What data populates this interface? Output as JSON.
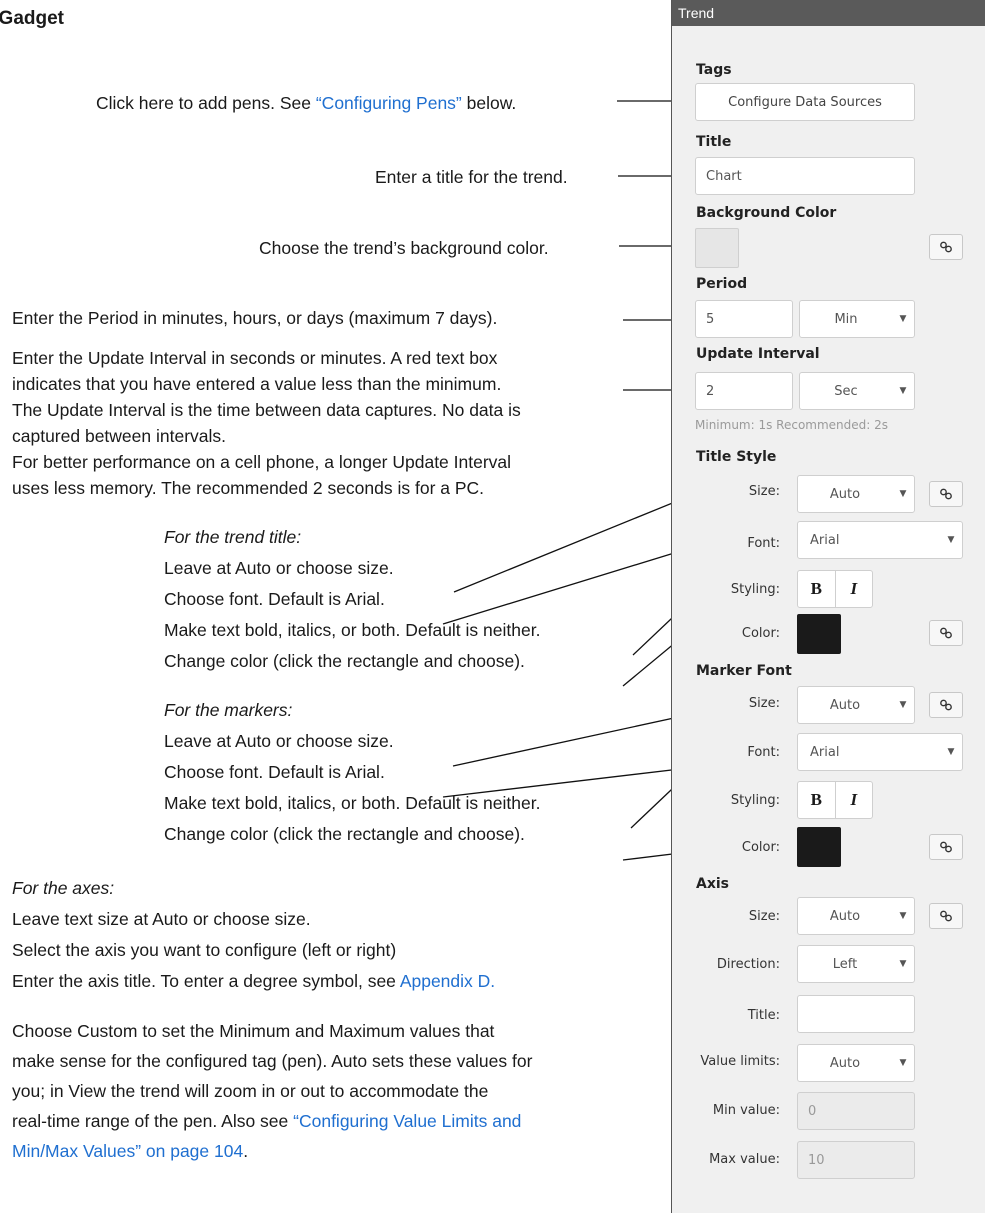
{
  "heading": "l Gadget",
  "panel": {
    "header": "Trend",
    "tags_label": "Tags",
    "configure_button": "Configure Data Sources",
    "title_label": "Title",
    "title_value": "Chart",
    "bg_color_label": "Background Color",
    "period_label": "Period",
    "period_value": "5",
    "period_unit": "Min",
    "update_label": "Update Interval",
    "update_value": "2",
    "update_unit": "Sec",
    "update_hint": "Minimum: 1s Recommended: 2s",
    "title_style_label": "Title Style",
    "marker_font_label": "Marker Font",
    "axis_label": "Axis",
    "size_label": "Size:",
    "font_label": "Font:",
    "styling_label": "Styling:",
    "color_label": "Color:",
    "size_value": "Auto",
    "font_value": "Arial",
    "bold": "B",
    "italic": "I",
    "direction_label": "Direction:",
    "direction_value": "Left",
    "axis_title_label": "Title:",
    "value_limits_label": "Value limits:",
    "value_limits_value": "Auto",
    "min_label": "Min value:",
    "min_value": "0",
    "max_label": "Max value:",
    "max_value": "10",
    "colors": {
      "header_bg": "#5a5a5a",
      "panel_bg": "#f0f0f0",
      "swatch_light": "#e6e6e6",
      "swatch_dark": "#1a1a1a"
    }
  },
  "annotations": {
    "tags_a": "Click here to add pens. See ",
    "tags_link": "“Configuring Pens”",
    "tags_b": " below.",
    "title": "Enter a title for the trend.",
    "bg": "Choose the trend’s background color.",
    "period": "Enter the Period in minutes, hours, or days (maximum 7 days).",
    "update_1": "Enter the Update Interval in seconds or minutes. A red text box",
    "update_2": "indicates that you have entered a value less than the minimum.",
    "update_3": "The Update Interval is the time between data captures. No data is",
    "update_4": "captured between intervals.",
    "update_5": "For better performance on a cell phone, a longer Update Interval",
    "update_6": "uses less memory. The recommended 2 seconds is for a PC.",
    "title_style_head": "For the trend title:",
    "ts_size": "Leave at Auto or choose size.",
    "ts_font": "Choose font. Default is Arial.",
    "ts_styling": "Make text bold, italics, or both. Default is neither.",
    "ts_color": "Change color (click the rectangle and choose).",
    "marker_head": "For the markers:",
    "mk_size": "Leave at Auto or choose size.",
    "mk_font": "Choose font. Default is Arial.",
    "mk_styling": "Make text bold, italics, or both. Default is neither.",
    "mk_color": "Change color (click the rectangle and choose).",
    "axes_head": "For the axes:",
    "ax_1": "Leave text size at Auto or choose size.",
    "ax_2": "Select the axis you want to configure (left or right)",
    "ax_3a": "Enter the axis title. To enter a degree symbol, see ",
    "ax_3link": "Appendix D.",
    "lim_1": "Choose Custom to set the Minimum and Maximum values that",
    "lim_2": "make sense for the configured tag (pen). Auto sets these values for",
    "lim_3": "you; in View the trend will zoom in or out to accommodate the",
    "lim_4a": "real-time range of the pen. Also see ",
    "lim_4link": "“Configuring Value Limits and",
    "lim_5link": "Min/Max Values” on page 104",
    "lim_5b": "."
  }
}
